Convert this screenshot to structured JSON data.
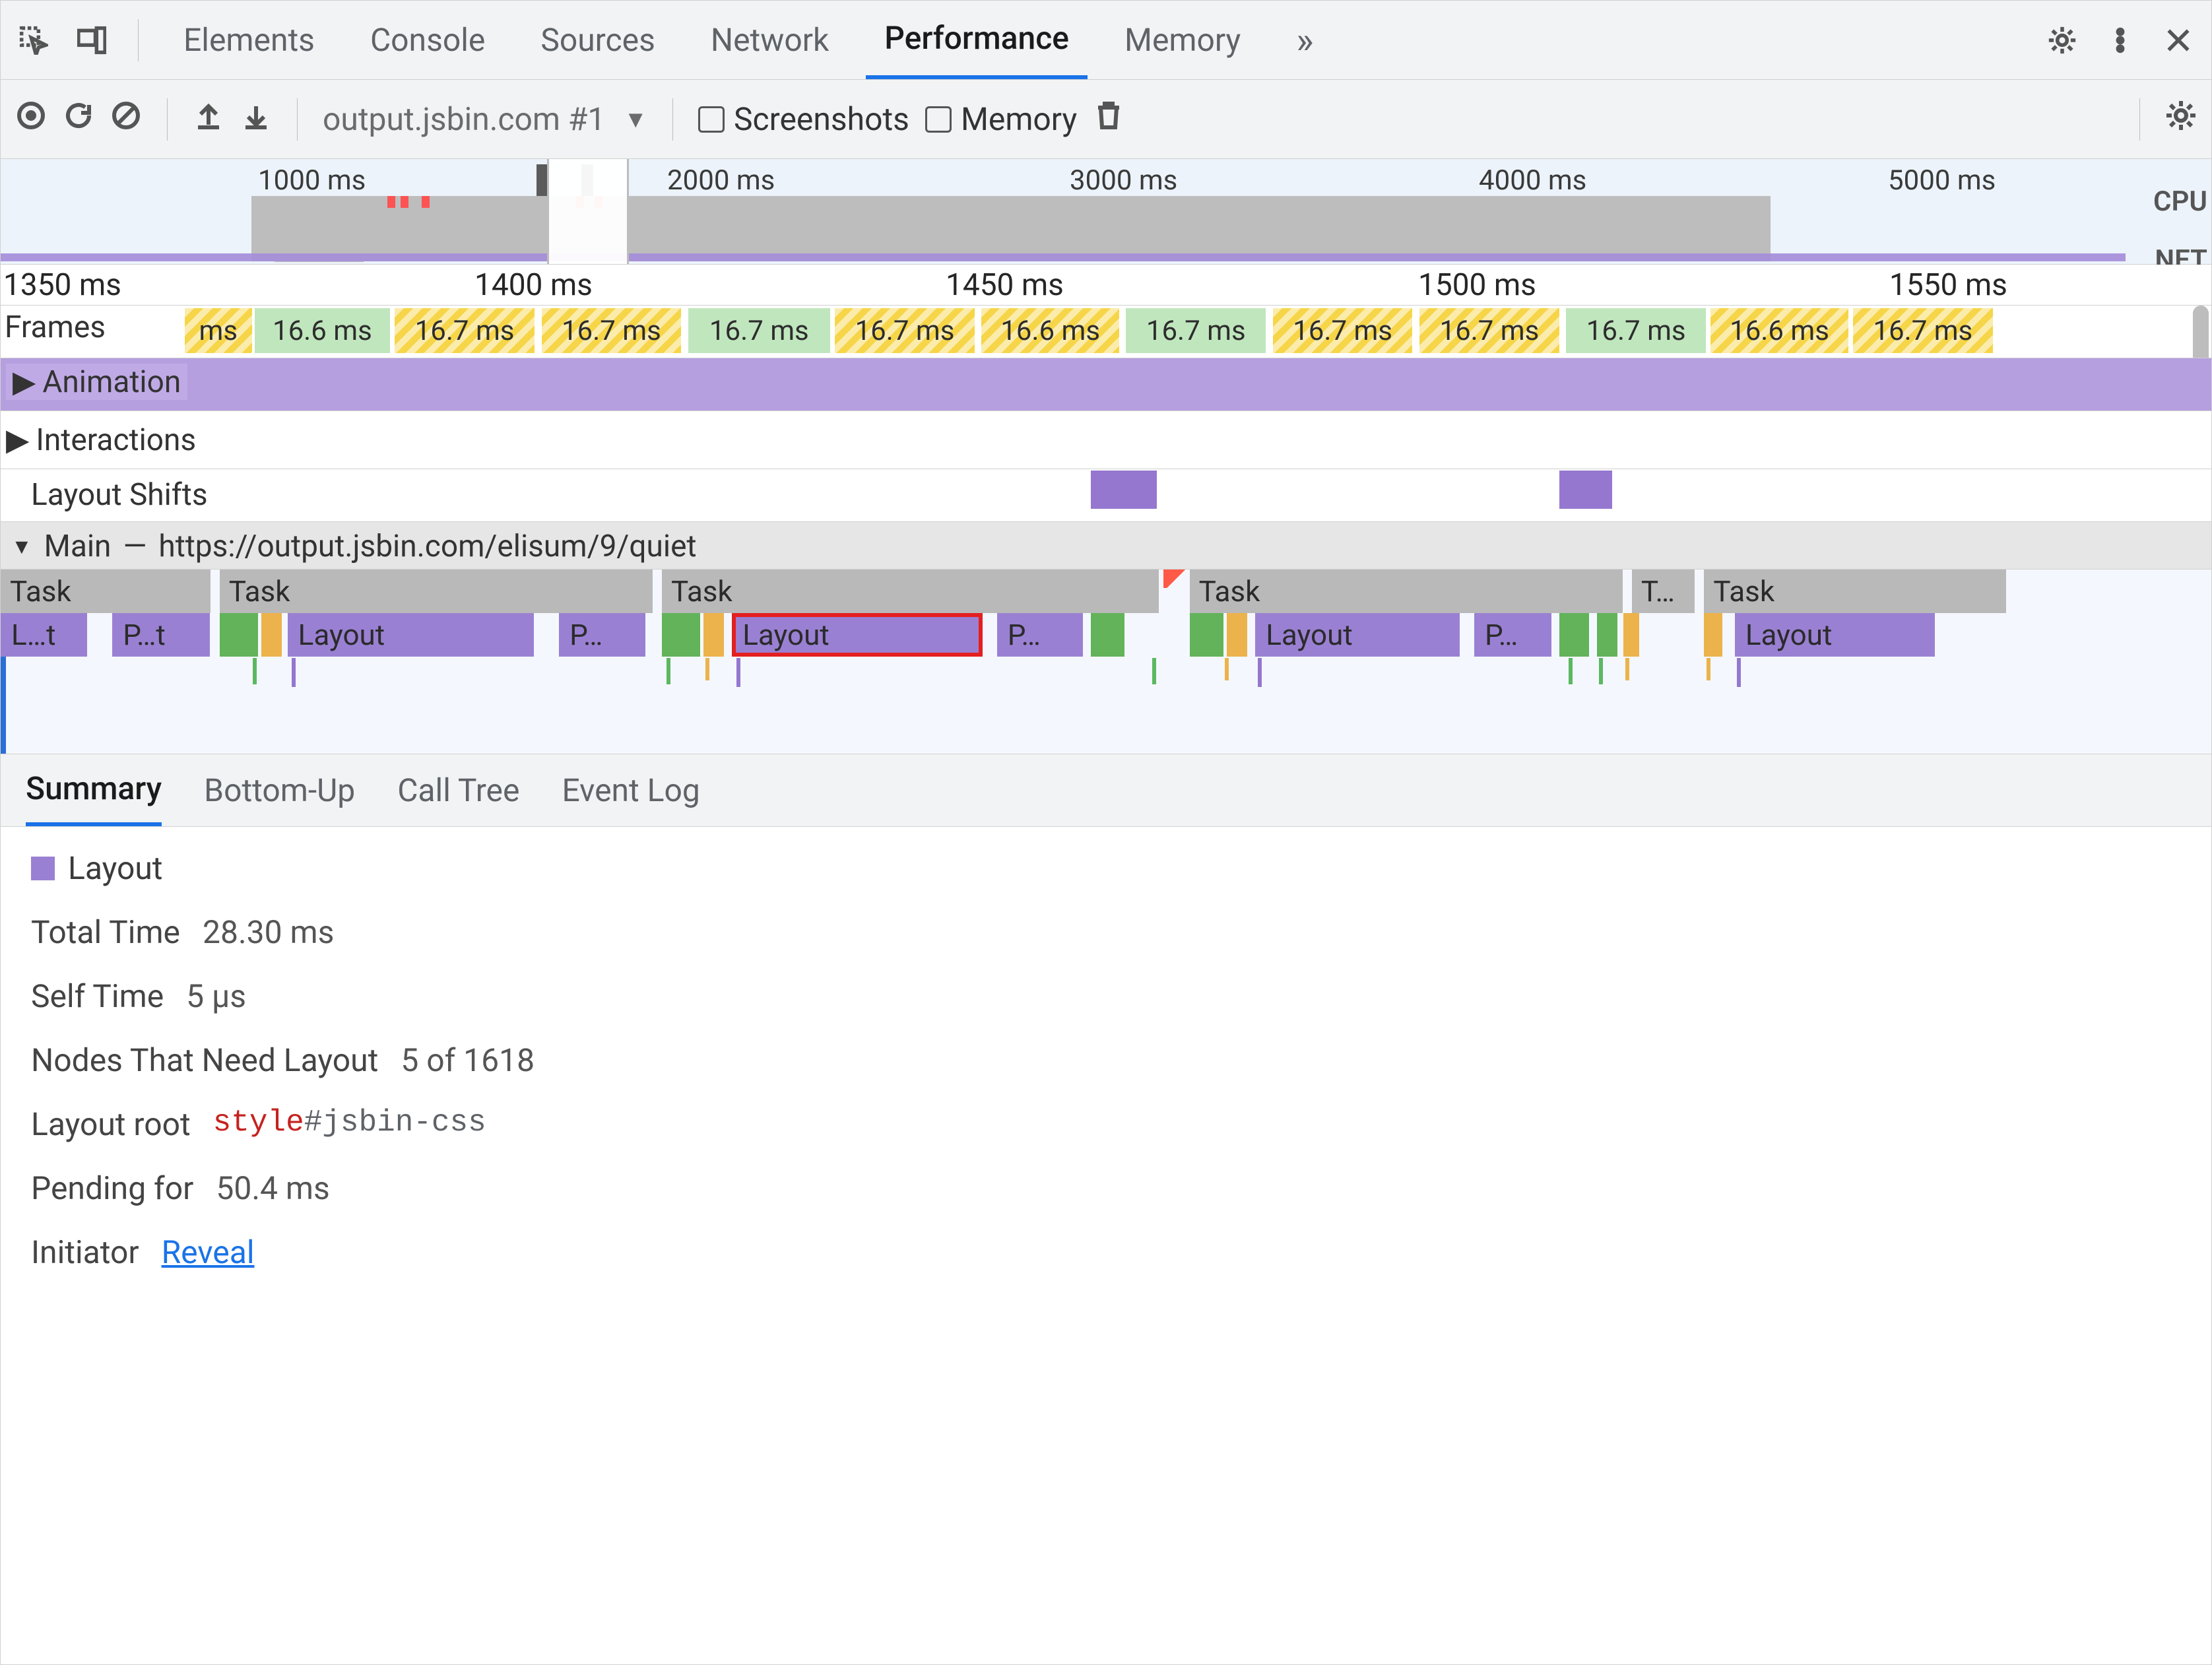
{
  "tabs": {
    "items": [
      "Elements",
      "Console",
      "Sources",
      "Network",
      "Performance",
      "Memory"
    ],
    "active": "Performance",
    "overflow": "»"
  },
  "toolbar": {
    "dropdown": "output.jsbin.com #1",
    "check_screenshots": "Screenshots",
    "check_memory": "Memory"
  },
  "overview": {
    "ticks": [
      "1000 ms",
      "2000 ms",
      "3000 ms",
      "4000 ms",
      "5000 ms"
    ],
    "label_cpu": "CPU",
    "label_net": "NET"
  },
  "ruler": {
    "ticks": [
      "1350 ms",
      "1400 ms",
      "1450 ms",
      "1500 ms",
      "1550 ms"
    ]
  },
  "frames": {
    "label": "Frames",
    "cells": [
      {
        "t": "ms",
        "c": "yellow",
        "x": 0.084,
        "w": 0.032
      },
      {
        "t": "16.6 ms",
        "c": "green",
        "x": 0.116,
        "w": 0.063
      },
      {
        "t": "16.7 ms",
        "c": "yellow",
        "x": 0.18,
        "w": 0.065
      },
      {
        "t": "16.7 ms",
        "c": "yellow",
        "x": 0.247,
        "w": 0.065
      },
      {
        "t": "16.7 ms",
        "c": "green",
        "x": 0.314,
        "w": 0.066
      },
      {
        "t": "16.7 ms",
        "c": "yellow",
        "x": 0.381,
        "w": 0.065
      },
      {
        "t": "16.6 ms",
        "c": "yellow",
        "x": 0.448,
        "w": 0.064
      },
      {
        "t": "16.7 ms",
        "c": "green",
        "x": 0.514,
        "w": 0.065
      },
      {
        "t": "16.7 ms",
        "c": "yellow",
        "x": 0.581,
        "w": 0.065
      },
      {
        "t": "16.7 ms",
        "c": "yellow",
        "x": 0.648,
        "w": 0.065
      },
      {
        "t": "16.7 ms",
        "c": "green",
        "x": 0.715,
        "w": 0.065
      },
      {
        "t": "16.6 ms",
        "c": "yellow",
        "x": 0.781,
        "w": 0.064
      },
      {
        "t": "16.7 ms",
        "c": "yellow",
        "x": 0.846,
        "w": 0.065
      }
    ]
  },
  "animation": {
    "label": "Animation"
  },
  "interactions": {
    "label": "Interactions"
  },
  "layout_shifts": {
    "label": "Layout Shifts",
    "blocks": [
      {
        "x": 0.498,
        "w": 0.03
      },
      {
        "x": 0.712,
        "w": 0.024
      }
    ]
  },
  "main": {
    "label": "Main",
    "sep": " — ",
    "url": "https://output.jsbin.com/elisum/9/quiet",
    "tasks": [
      {
        "label": "Task",
        "x": 0.0,
        "w": 0.097
      },
      {
        "label": "Task",
        "x": 0.1,
        "w": 0.199
      },
      {
        "label": "Task",
        "x": 0.302,
        "w": 0.228
      },
      {
        "label": "Task",
        "x": 0.543,
        "w": 0.199
      },
      {
        "label": "T…",
        "x": 0.745,
        "w": 0.03
      },
      {
        "label": "Task",
        "x": 0.778,
        "w": 0.139
      }
    ],
    "red_wedge_x": 0.531,
    "lvl2": [
      {
        "type": "purple",
        "label": "L…t",
        "x": 0.0,
        "w": 0.04
      },
      {
        "type": "purple",
        "label": "P…t",
        "x": 0.051,
        "w": 0.045
      },
      {
        "type": "green",
        "label": "",
        "x": 0.1,
        "w": 0.018
      },
      {
        "type": "orange",
        "label": "",
        "x": 0.119,
        "w": 0.01
      },
      {
        "type": "purple",
        "label": "Layout",
        "x": 0.131,
        "w": 0.113
      },
      {
        "type": "purple",
        "label": "P…",
        "x": 0.255,
        "w": 0.04
      },
      {
        "type": "green",
        "label": "",
        "x": 0.302,
        "w": 0.018
      },
      {
        "type": "orange",
        "label": "",
        "x": 0.321,
        "w": 0.01
      },
      {
        "type": "purple",
        "label": "Layout",
        "x": 0.334,
        "w": 0.115,
        "selected": true
      },
      {
        "type": "purple",
        "label": "P…",
        "x": 0.455,
        "w": 0.04
      },
      {
        "type": "green",
        "label": "",
        "x": 0.498,
        "w": 0.016
      },
      {
        "type": "green",
        "label": "",
        "x": 0.543,
        "w": 0.016
      },
      {
        "type": "orange",
        "label": "",
        "x": 0.56,
        "w": 0.01
      },
      {
        "type": "purple",
        "label": "Layout",
        "x": 0.573,
        "w": 0.094
      },
      {
        "type": "purple",
        "label": "P…",
        "x": 0.673,
        "w": 0.036
      },
      {
        "type": "green",
        "label": "",
        "x": 0.712,
        "w": 0.014
      },
      {
        "type": "green",
        "label": "",
        "x": 0.729,
        "w": 0.01
      },
      {
        "type": "orange",
        "label": "",
        "x": 0.741,
        "w": 0.008
      },
      {
        "type": "orange",
        "label": "",
        "x": 0.778,
        "w": 0.009
      },
      {
        "type": "purple",
        "label": "Layout",
        "x": 0.792,
        "w": 0.092
      }
    ],
    "marks": [
      {
        "c": "g",
        "x": 0.115
      },
      {
        "c": "p",
        "x": 0.133
      },
      {
        "c": "g",
        "x": 0.304
      },
      {
        "c": "o",
        "x": 0.322
      },
      {
        "c": "p",
        "x": 0.336
      },
      {
        "c": "g",
        "x": 0.526
      },
      {
        "c": "o",
        "x": 0.559
      },
      {
        "c": "p",
        "x": 0.574
      },
      {
        "c": "g",
        "x": 0.716
      },
      {
        "c": "g",
        "x": 0.73
      },
      {
        "c": "o",
        "x": 0.742
      },
      {
        "c": "o",
        "x": 0.779
      },
      {
        "c": "p",
        "x": 0.793
      }
    ]
  },
  "details": {
    "tabs": [
      "Summary",
      "Bottom-Up",
      "Call Tree",
      "Event Log"
    ],
    "active": "Summary"
  },
  "summary": {
    "type": "Layout",
    "total_time_k": "Total Time",
    "total_time_v": "28.30 ms",
    "self_time_k": "Self Time",
    "self_time_v": "5 μs",
    "nodes_k": "Nodes That Need Layout",
    "nodes_v": "5 of 1618",
    "layout_root_k": "Layout root",
    "layout_root_el": "style",
    "layout_root_sel": "#jsbin-css",
    "pending_k": "Pending for",
    "pending_v": "50.4 ms",
    "initiator_k": "Initiator",
    "initiator_link": "Reveal"
  }
}
